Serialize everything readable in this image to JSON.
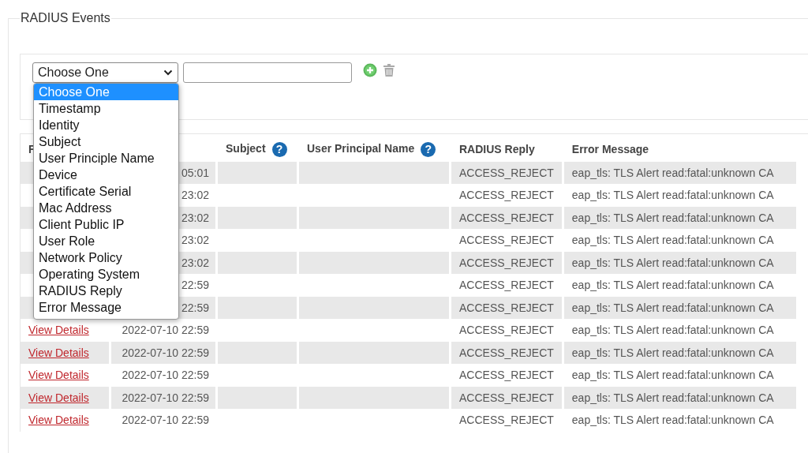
{
  "section": {
    "title": "RADIUS Events"
  },
  "filter": {
    "select": {
      "value": "Choose One",
      "options": [
        {
          "label": "Choose One",
          "selected": true
        },
        {
          "label": "Timestamp",
          "selected": false
        },
        {
          "label": "Identity",
          "selected": false
        },
        {
          "label": "Subject",
          "selected": false
        },
        {
          "label": "User Principle Name",
          "selected": false
        },
        {
          "label": "Device",
          "selected": false
        },
        {
          "label": "Certificate Serial",
          "selected": false
        },
        {
          "label": "Mac Address",
          "selected": false
        },
        {
          "label": "Client Public IP",
          "selected": false
        },
        {
          "label": "User Role",
          "selected": false
        },
        {
          "label": "Network Policy",
          "selected": false
        },
        {
          "label": "Operating System",
          "selected": false
        },
        {
          "label": "RADIUS Reply",
          "selected": false
        },
        {
          "label": "Error Message",
          "selected": false
        }
      ]
    }
  },
  "table": {
    "columns": [
      {
        "label": "F"
      },
      {
        "label": "Subject",
        "help": "?"
      },
      {
        "label": "User Principal Name",
        "help": "?"
      },
      {
        "label": "RADIUS Reply"
      },
      {
        "label": "Error Message"
      }
    ],
    "rows": [
      {
        "time": "05:01",
        "reply": "ACCESS_REJECT",
        "error": "eap_tls: TLS Alert read:fatal:unknown CA"
      },
      {
        "time": "23:02",
        "reply": "ACCESS_REJECT",
        "error": "eap_tls: TLS Alert read:fatal:unknown CA"
      },
      {
        "time": "23:02",
        "reply": "ACCESS_REJECT",
        "error": "eap_tls: TLS Alert read:fatal:unknown CA"
      },
      {
        "time": "23:02",
        "reply": "ACCESS_REJECT",
        "error": "eap_tls: TLS Alert read:fatal:unknown CA"
      },
      {
        "time": "23:02",
        "reply": "ACCESS_REJECT",
        "error": "eap_tls: TLS Alert read:fatal:unknown CA"
      },
      {
        "time": "22:59",
        "reply": "ACCESS_REJECT",
        "error": "eap_tls: TLS Alert read:fatal:unknown CA"
      },
      {
        "time": "22:59",
        "reply": "ACCESS_REJECT",
        "error": "eap_tls: TLS Alert read:fatal:unknown CA"
      },
      {
        "link": "View Details",
        "time": "2022-07-10 22:59",
        "reply": "ACCESS_REJECT",
        "error": "eap_tls: TLS Alert read:fatal:unknown CA"
      },
      {
        "link": "View Details",
        "time": "2022-07-10 22:59",
        "reply": "ACCESS_REJECT",
        "error": "eap_tls: TLS Alert read:fatal:unknown CA"
      },
      {
        "link": "View Details",
        "time": "2022-07-10 22:59",
        "reply": "ACCESS_REJECT",
        "error": "eap_tls: TLS Alert read:fatal:unknown CA"
      },
      {
        "link": "View Details",
        "time": "2022-07-10 22:59",
        "reply": "ACCESS_REJECT",
        "error": "eap_tls: TLS Alert read:fatal:unknown CA"
      },
      {
        "link": "View Details",
        "time": "2022-07-10 22:59",
        "reply": "ACCESS_REJECT",
        "error": "eap_tls: TLS Alert read:fatal:unknown CA"
      }
    ]
  }
}
